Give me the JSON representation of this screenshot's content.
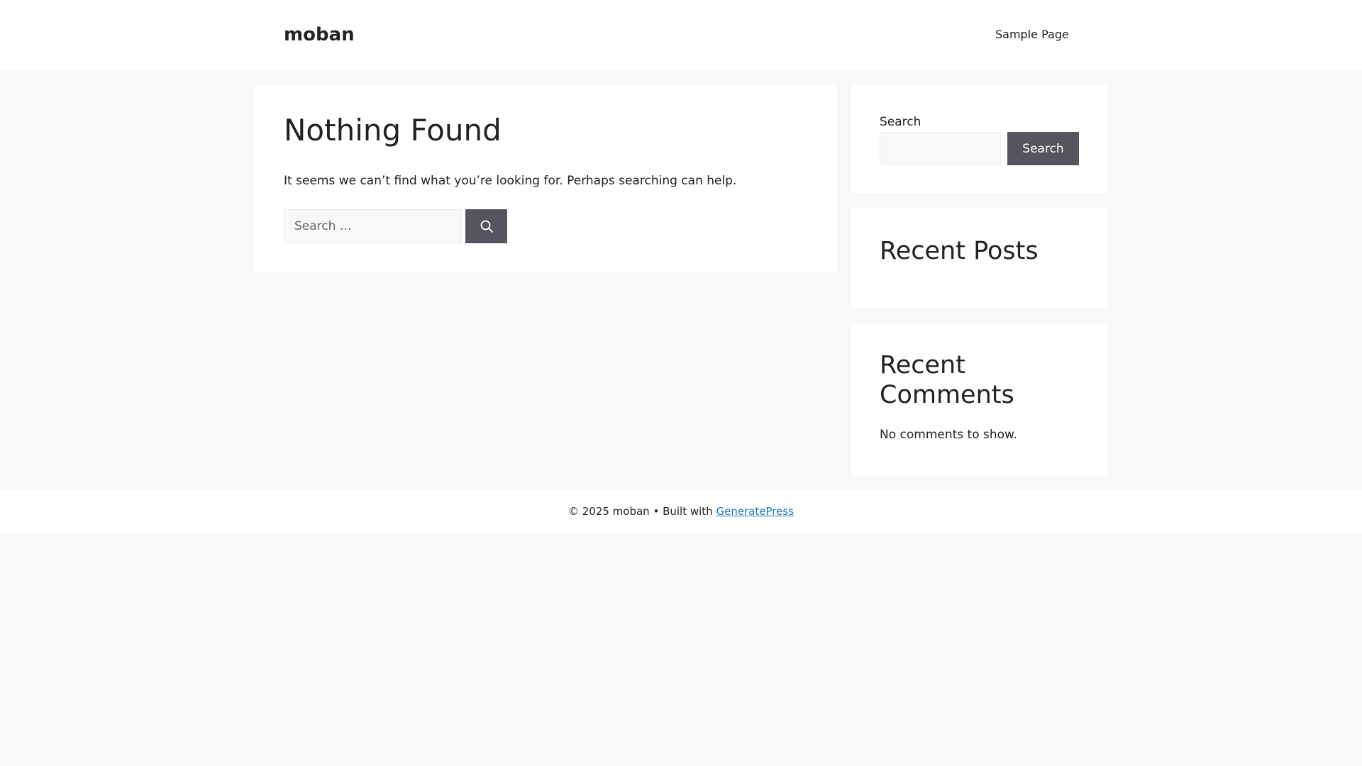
{
  "header": {
    "site_title": "moban",
    "nav_items": [
      "Sample Page"
    ]
  },
  "main": {
    "title": "Nothing Found",
    "message": "It seems we can’t find what you’re looking for. Perhaps searching can help.",
    "search_placeholder": "Search …",
    "search_value": "",
    "search_button_icon": "search-icon"
  },
  "sidebar": {
    "search_widget": {
      "label": "Search",
      "input_value": "",
      "button_label": "Search"
    },
    "recent_posts": {
      "title": "Recent Posts"
    },
    "recent_comments": {
      "title": "Recent Comments",
      "empty_text": "No comments to show."
    }
  },
  "footer": {
    "copyright": "© 2025 moban",
    "separator": " • ",
    "built_with": "Built with ",
    "link_text": "GeneratePress"
  },
  "colors": {
    "page_background": "#f7f8f9",
    "card_background": "#ffffff",
    "button_background": "#55555e",
    "link_color": "#1e73be",
    "text_color": "#222222"
  }
}
